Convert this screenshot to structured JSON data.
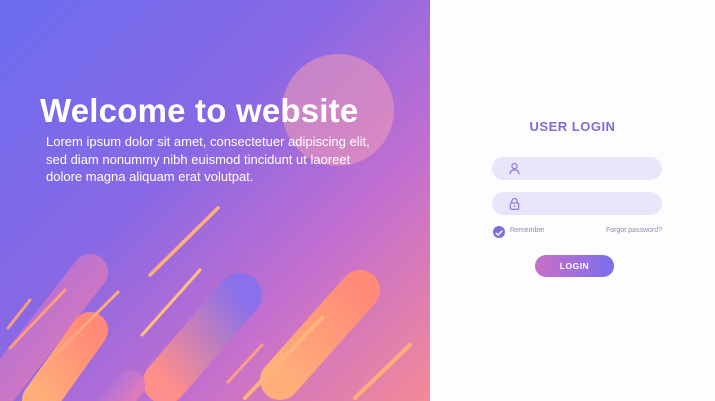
{
  "hero": {
    "title": "Welcome to website",
    "body": "Lorem ipsum dolor sit amet, consectetuer adipiscing elit, sed diam nonummy nibh euismod tincidunt ut laoreet dolore magna aliquam erat volutpat."
  },
  "login": {
    "title": "USER LOGIN",
    "username": {
      "value": "",
      "placeholder": "",
      "icon": "user-icon"
    },
    "password": {
      "value": "",
      "placeholder": "",
      "icon": "lock-icon"
    },
    "remember": {
      "label": "Remember",
      "checked": true,
      "icon": "check-icon"
    },
    "forgot_label": "Forgot password?",
    "button_label": "LOGIN"
  },
  "colors": {
    "accent": "#7a6fd8",
    "field_bg": "#e9e6fb",
    "gradient_start": "#6c6df0",
    "gradient_end": "#f48a96"
  }
}
